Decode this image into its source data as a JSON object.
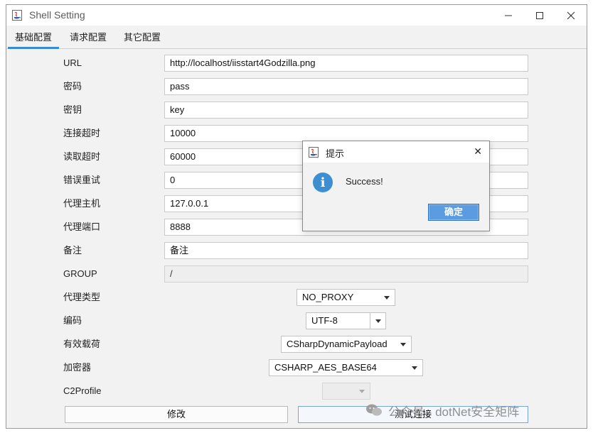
{
  "window": {
    "title": "Shell Setting",
    "icon": "java-cup-icon",
    "controls": {
      "minimize": "—",
      "maximize": "☐",
      "close": "✕"
    }
  },
  "tabs": [
    {
      "label": "基础配置",
      "active": true
    },
    {
      "label": "请求配置",
      "active": false
    },
    {
      "label": "其它配置",
      "active": false
    }
  ],
  "form": {
    "url": {
      "label": "URL",
      "value": "http://localhost/iisstart4Godzilla.png"
    },
    "password": {
      "label": "密码",
      "value": "pass"
    },
    "secret_key": {
      "label": "密钥",
      "value": "key"
    },
    "connect_timeout": {
      "label": "连接超时",
      "value": "10000"
    },
    "read_timeout": {
      "label": "读取超时",
      "value": "60000"
    },
    "retry": {
      "label": "错误重试",
      "value": "0"
    },
    "proxy_host": {
      "label": "代理主机",
      "value": "127.0.0.1"
    },
    "proxy_port": {
      "label": "代理端口",
      "value": "8888"
    },
    "remark": {
      "label": "备注",
      "value": "备注"
    },
    "group": {
      "label": "GROUP",
      "value": "/"
    },
    "proxy_type": {
      "label": "代理类型",
      "value": "NO_PROXY"
    },
    "encoding": {
      "label": "编码",
      "value": "UTF-8"
    },
    "payload": {
      "label": "有效载荷",
      "value": "CSharpDynamicPayload"
    },
    "cryption": {
      "label": "加密器",
      "value": "CSHARP_AES_BASE64"
    },
    "c2profile": {
      "label": "C2Profile",
      "value": ""
    }
  },
  "buttons": {
    "modify": "修改",
    "test_connection": "测试连接"
  },
  "dialog": {
    "title": "提示",
    "message": "Success!",
    "ok": "确定",
    "close": "✕",
    "icon": "info-icon"
  },
  "watermark": {
    "text": "公众号 · dotNet安全矩阵"
  },
  "colors": {
    "tab_accent": "#3c8ad6",
    "ok_button": "#5b9be0",
    "info_icon": "#3d8fd1"
  }
}
